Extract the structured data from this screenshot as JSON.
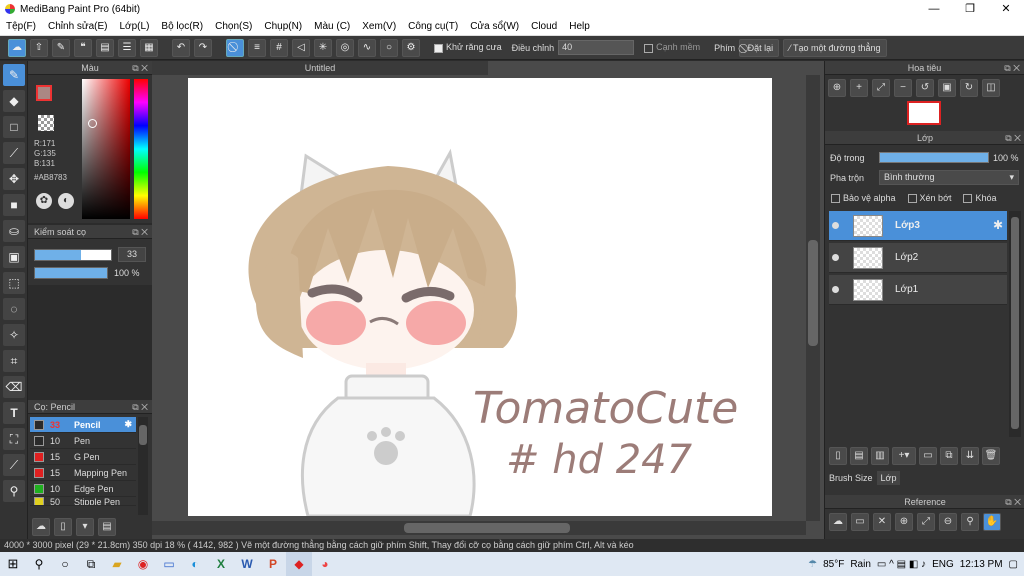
{
  "window": {
    "title": "MediBang Paint Pro (64bit)",
    "minimize": "—",
    "maximize": "❐",
    "close": "✕"
  },
  "menu": [
    "Tệp(F)",
    "Chỉnh sửa(E)",
    "Lớp(L)",
    "Bộ lọc(R)",
    "Chọn(S)",
    "Chụp(N)",
    "Màu (C)",
    "Xem(V)",
    "Công cụ(T)",
    "Cửa sổ(W)",
    "Cloud",
    "Help"
  ],
  "toolbar": {
    "antialias_label": "Khử răng cưa",
    "adjust_label": "Điều chỉnh",
    "adjust_value": "40",
    "smooth_edge_label": "Cạnh mềm",
    "key_label": "Phím",
    "reset_label": "Đặt lại",
    "straight_line_label": "Tạo một đường thẳng"
  },
  "color_panel": {
    "title": "Màu",
    "r": "R:171",
    "g": "G:135",
    "b": "B:131",
    "hex": "#AB8783",
    "primary_color": "#AB8783",
    "secondary_color": "#e8c8b8"
  },
  "brush_control": {
    "title": "Kiểm soát cọ",
    "size": "33",
    "opacity": "100 %",
    "size_fraction": 0.6,
    "opacity_fraction": 1.0
  },
  "brush_panel": {
    "title": "Cọ: Pencil",
    "items": [
      {
        "size": "33",
        "name": "Pencil",
        "color": "#2a2a2a",
        "selected": true
      },
      {
        "size": "10",
        "name": "Pen",
        "color": "#2a2a2a"
      },
      {
        "size": "15",
        "name": "G Pen",
        "color": "#e02020"
      },
      {
        "size": "15",
        "name": "Mapping Pen",
        "color": "#e02020"
      },
      {
        "size": "10",
        "name": "Edge Pen",
        "color": "#20b020"
      },
      {
        "size": "50",
        "name": "Stipple Pen",
        "color": "#e0d020"
      }
    ]
  },
  "canvas": {
    "tab": "Untitled",
    "art_text_line1": "TomatoCute",
    "art_text_line2": "# hd 247"
  },
  "navigator": {
    "title": "Hoa tiêu"
  },
  "layers": {
    "title": "Lớp",
    "opacity_label": "Độ trong",
    "opacity_value": "100 %",
    "blend_label": "Pha trộn",
    "blend_value": "Bình thường",
    "protect_alpha": "Bảo vệ alpha",
    "clipping": "Xén bớt",
    "lock": "Khóa",
    "items": [
      {
        "name": "Lớp3",
        "selected": true
      },
      {
        "name": "Lớp2"
      },
      {
        "name": "Lớp1"
      }
    ],
    "tab_brush_size": "Brush Size",
    "tab_layer": "Lớp"
  },
  "reference": {
    "title": "Reference"
  },
  "status": {
    "text": "4000 * 3000 pixel  (29 * 21.8cm)  350 dpi  18 %  ( 4142, 982 )  Vẽ một đường thẳng bằng cách giữ phím Shift, Thay đổi cỡ cọ bằng cách giữ phím Ctrl, Alt và kéo"
  },
  "taskbar": {
    "temp": "85°F",
    "weather": "Rain",
    "lang": "ENG",
    "time": "12:13 PM"
  }
}
